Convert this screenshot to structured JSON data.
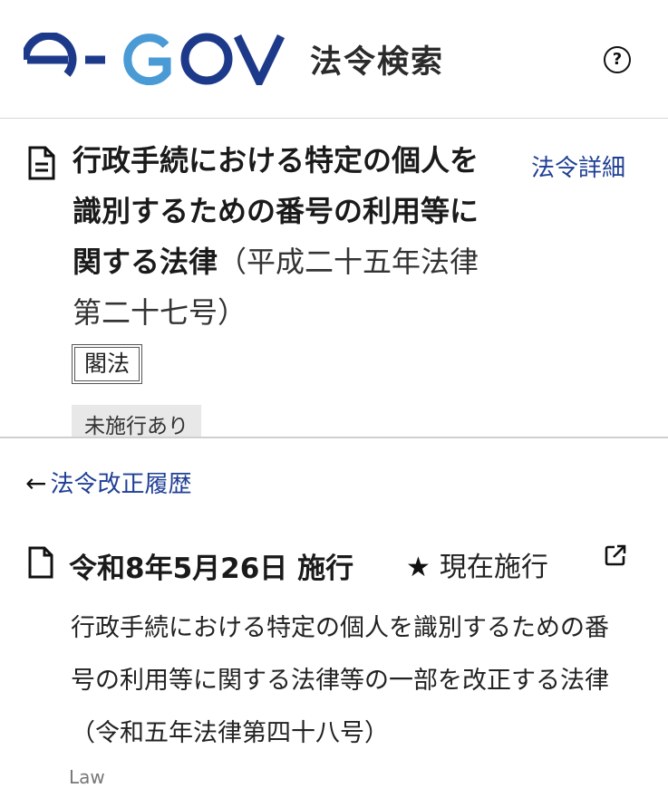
{
  "header": {
    "logo_alt": "e-GOV",
    "site_title": "法令検索",
    "help_icon": "question-circle-icon"
  },
  "law": {
    "title": "行政手続における特定の個人を識別するための番号の利用等に関する法律",
    "number": "（平成二十五年法律第二十七号）",
    "detail_link": "法令詳細",
    "tag_kaku": "閣法",
    "tag_mishiko": "未施行あり"
  },
  "history": {
    "link": "法令改正履歴"
  },
  "revision": {
    "date": "令和8年5月26日 施行",
    "current_label": "現在施行",
    "description": "行政手続における特定の個人を識別するための番号の利用等に関する法律等の一部を改正する法律（令和五年法律第四十八号）",
    "law_label": "Law"
  },
  "colors": {
    "logo_navy": "#1d3a8a",
    "logo_light_blue": "#4a9ad6",
    "link_blue": "#1f3f94"
  }
}
